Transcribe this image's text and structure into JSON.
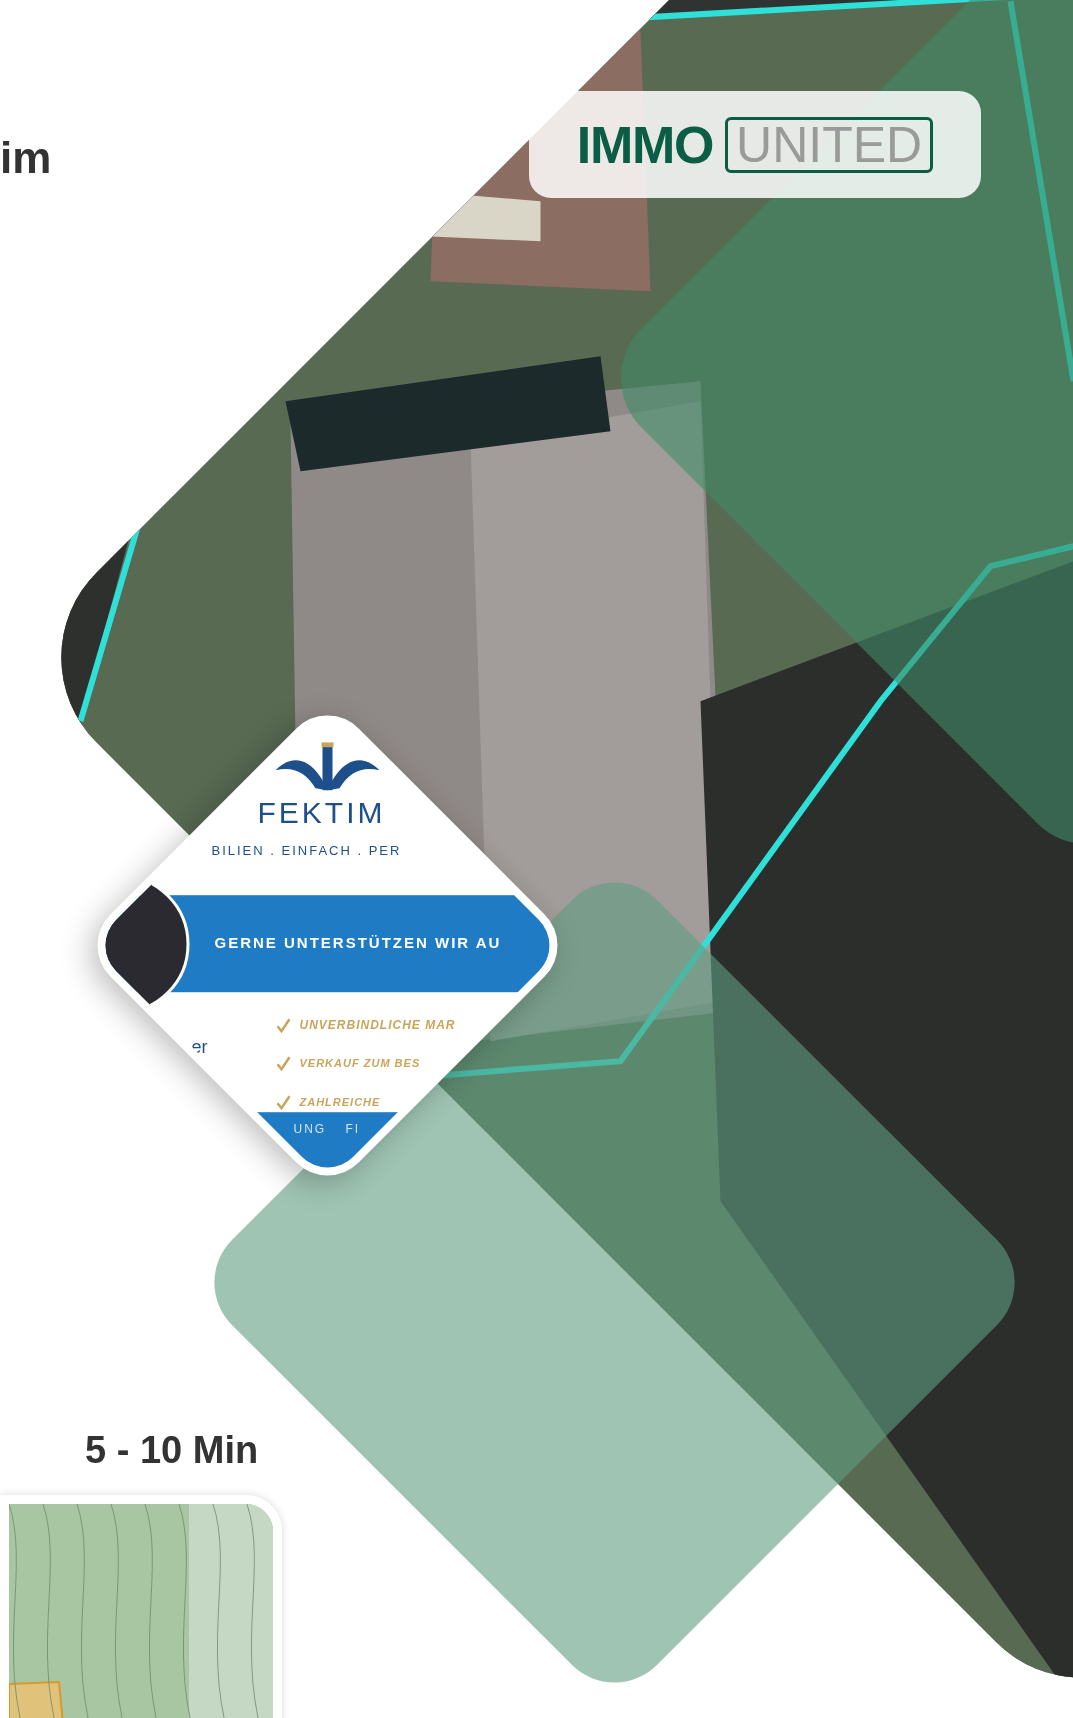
{
  "intro": {
    "heading_fragment": "im"
  },
  "logo": {
    "word": "IMMO",
    "boxed_word": "UNITED"
  },
  "ad_card": {
    "brand": "FEKTIM",
    "tagline": "BILIEN . EINFACH . PER",
    "banner": "GERNE UNTERSTÜTZEN WIR AU",
    "side_text": "er",
    "checklist": [
      "UNVERBINDLICHE MAR",
      "VERKAUF ZUM BES",
      "ZAHLREICHE"
    ],
    "nav": [
      "UNG",
      "FI"
    ]
  },
  "duration": "5 - 10 Min"
}
